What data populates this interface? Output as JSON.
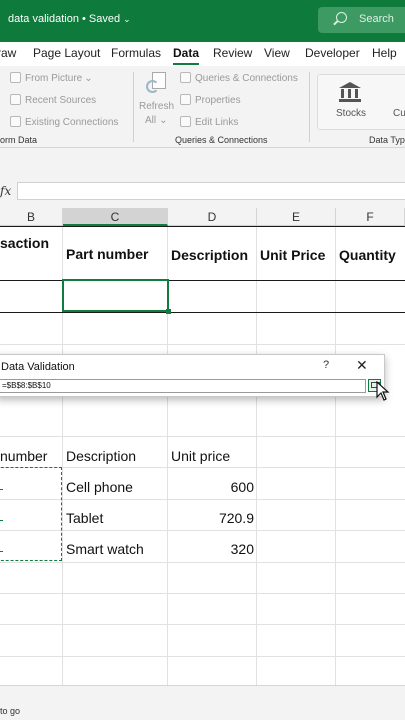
{
  "titlebar": {
    "doc_title": "data validation • Saved",
    "caret": "⌄",
    "search_placeholder": "Search",
    "accent": "#0e7a3b"
  },
  "tabs": [
    "raw",
    "Page Layout",
    "Formulas",
    "Data",
    "Review",
    "View",
    "Developer",
    "Help"
  ],
  "active_tab": "Data",
  "ribbon": {
    "get_data": [
      "From Picture",
      "Recent Sources",
      "Existing Connections"
    ],
    "get_data_dropdown": "⌄",
    "group1_label": "orm Data",
    "refresh_label": "Refresh",
    "refresh_sub": "All",
    "refresh_caret": "⌄",
    "queries": [
      "Queries & Connections",
      "Properties",
      "Edit Links"
    ],
    "group2_label": "Queries & Connections",
    "stocks_label": "Stocks",
    "currencies_label": "Cu",
    "group3_label": "Data Typ"
  },
  "formula_bar": {
    "fx": "fx",
    "value": ""
  },
  "columns": [
    {
      "label": "B"
    },
    {
      "label": "C",
      "selected": true
    },
    {
      "label": "D"
    },
    {
      "label": "E"
    },
    {
      "label": "F"
    }
  ],
  "table1_headers": [
    "saction",
    "Part number",
    "Description",
    "Unit Price",
    "Quantity"
  ],
  "table2": {
    "headers": [
      "number",
      "Description",
      "Unit price"
    ],
    "rows": [
      {
        "b": "-",
        "desc": "Cell phone",
        "price": "600"
      },
      {
        "b": "-",
        "desc": "Tablet",
        "price": "720.9"
      },
      {
        "b": "-",
        "desc": "Smart watch",
        "price": "320"
      }
    ]
  },
  "dialog": {
    "title": "Data Validation",
    "help": "?",
    "close": "✕",
    "value": "=$B$8:$B$10"
  },
  "status": {
    "text": "to go"
  }
}
